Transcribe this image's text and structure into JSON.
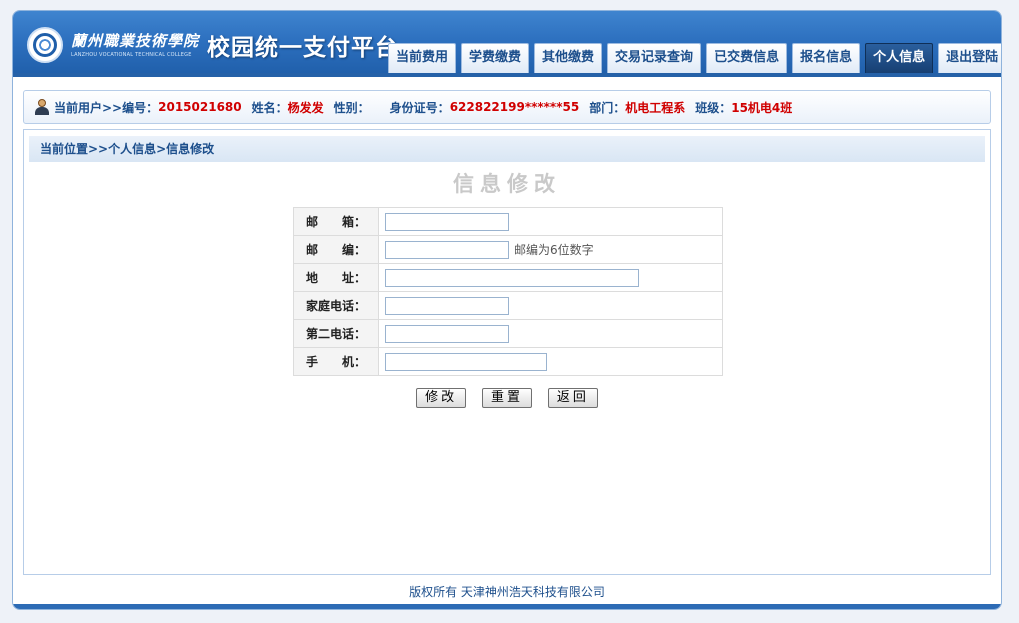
{
  "header": {
    "school_cn": "蘭州職業技術學院",
    "school_en": "LANZHOU VOCATIONAL TECHNICAL COLLEGE",
    "platform_title": "校园统一支付平台",
    "tabs": [
      {
        "label": "当前费用"
      },
      {
        "label": "学费缴费"
      },
      {
        "label": "其他缴费"
      },
      {
        "label": "交易记录查询"
      },
      {
        "label": "已交费信息"
      },
      {
        "label": "报名信息"
      },
      {
        "label": "个人信息",
        "active": true
      },
      {
        "label": "退出登陆"
      }
    ]
  },
  "user": {
    "prefix": "当前用户>>编号：",
    "id": "2015021680",
    "name_label": "姓名：",
    "name": "杨发发",
    "gender_label": "性别：",
    "gender": "",
    "idcard_label": "身份证号：",
    "idcard": "622822199******55",
    "dept_label": "部门：",
    "dept": "机电工程系",
    "class_label": "班级：",
    "class": "15机电4班"
  },
  "breadcrumb": "当前位置>>个人信息>信息修改",
  "form": {
    "title": "信息修改",
    "fields": [
      {
        "label": "邮　　箱：",
        "value": ""
      },
      {
        "label": "邮　　编：",
        "value": "",
        "hint": "邮编为6位数字"
      },
      {
        "label": "地　　址：",
        "value": ""
      },
      {
        "label": "家庭电话：",
        "value": ""
      },
      {
        "label": "第二电话：",
        "value": ""
      },
      {
        "label": "手　　机：",
        "value": ""
      }
    ],
    "buttons": {
      "modify": "修改",
      "reset": "重置",
      "back": "返回"
    }
  },
  "footer": "版权所有 天津神州浩天科技有限公司",
  "colors": {
    "brand": "#2d70bf",
    "accent_red": "#d00000",
    "nav_text": "#1d4f8c"
  }
}
